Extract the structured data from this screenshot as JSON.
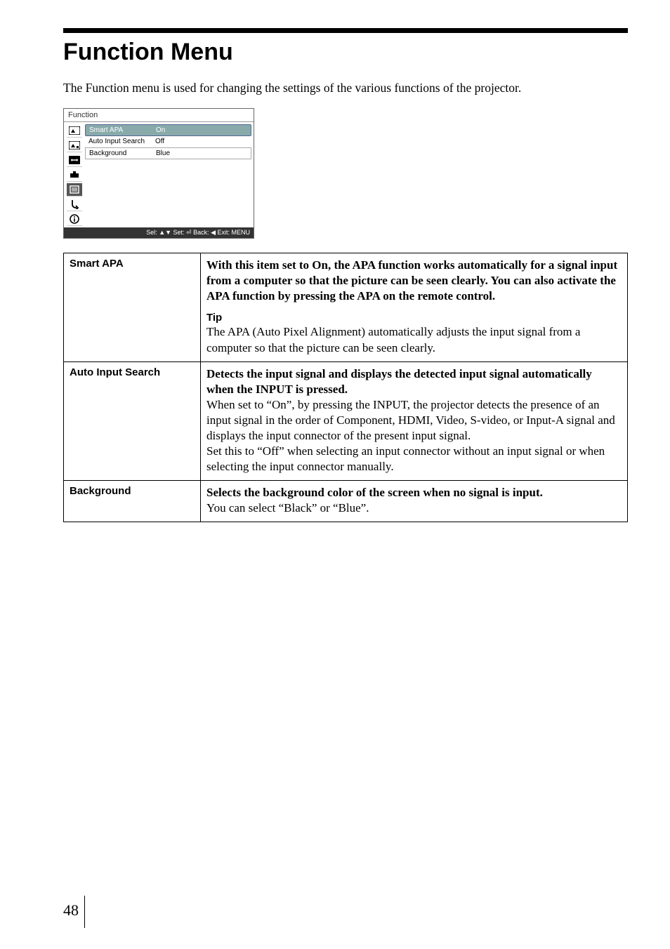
{
  "page": {
    "title": "Function Menu",
    "intro": "The Function menu is used for changing the settings of the various functions of the projector.",
    "page_number": "48"
  },
  "osd": {
    "title": "Function",
    "rows": [
      {
        "label": "Smart APA",
        "value": "On",
        "selected": true
      },
      {
        "label": "Auto Input Search",
        "value": "Off",
        "selected": false
      },
      {
        "label": "Background",
        "value": "Blue",
        "selected": false
      }
    ],
    "footer": "Sel: ▲▼  Set: ⏎  Back: ◀  Exit: MENU"
  },
  "settings": [
    {
      "name": "Smart APA",
      "lead": "With this item set to On, the APA function works automatically for a signal input from a computer so that the picture can be seen clearly. You can also activate the APA function by pressing the APA on the remote control.",
      "tip_heading": "Tip",
      "tip_body": "The APA (Auto Pixel Alignment) automatically adjusts the input signal from a computer so that the picture can be seen clearly."
    },
    {
      "name": "Auto Input Search",
      "lead": "Detects the input signal and displays the detected input signal automatically when the INPUT is pressed.",
      "body": "When set to “On”, by pressing the INPUT, the projector detects the presence of an input signal in the order of Component, HDMI, Video, S-video, or Input-A signal and displays the input connector of the present input signal.\nSet this to “Off” when selecting an input connector without an input signal or when selecting the input connector manually."
    },
    {
      "name": "Background",
      "lead": "Selects the background color of the screen when no signal is input.",
      "body": "You can select “Black” or “Blue”."
    }
  ]
}
